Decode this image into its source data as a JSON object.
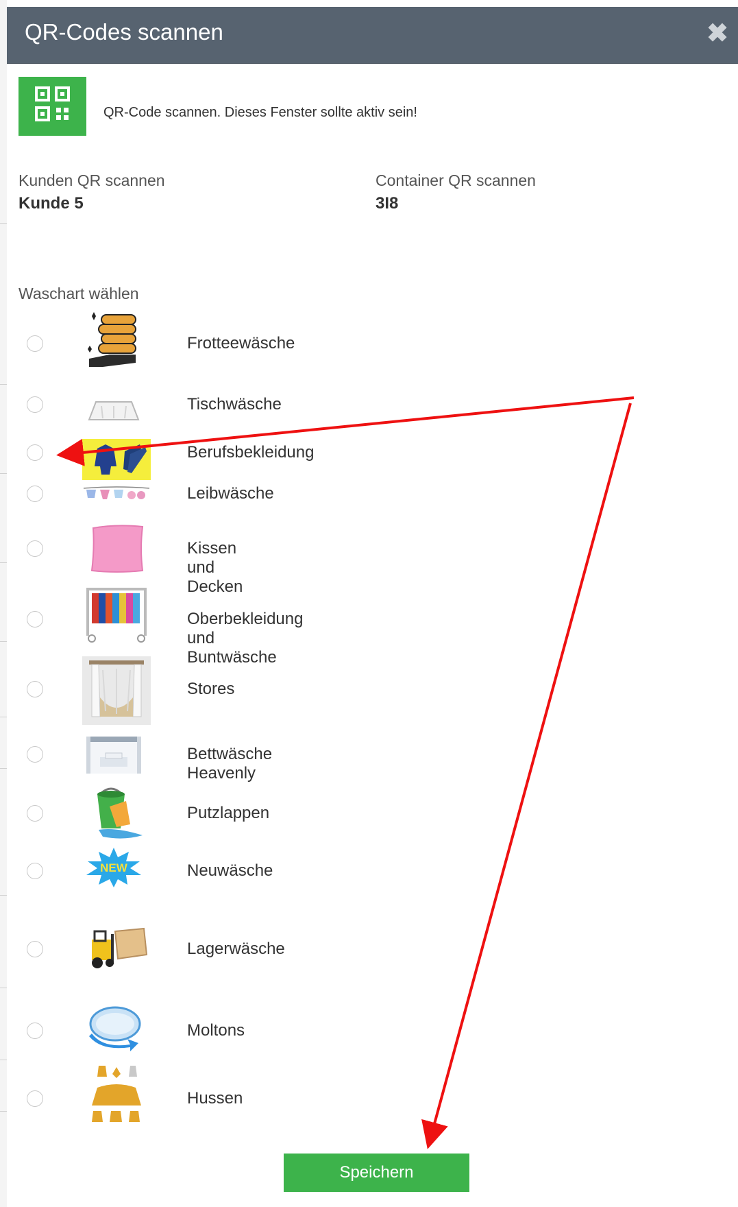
{
  "dialog": {
    "title": "QR-Codes scannen",
    "close_glyph": "✖",
    "hint": "QR-Code scannen. Dieses Fenster sollte aktiv sein!"
  },
  "customer": {
    "label": "Kunden QR scannen",
    "value": "Kunde 5"
  },
  "container": {
    "label": "Container QR scannen",
    "value": "3I8"
  },
  "wash_type": {
    "label": "Waschart wählen",
    "options": [
      {
        "label": "Frotteewäsche",
        "icon": "towel-stack-icon"
      },
      {
        "label": "Tischwäsche",
        "icon": "tablecloth-icon"
      },
      {
        "label": "Berufsbekleidung",
        "icon": "workwear-icon"
      },
      {
        "label": "Leibwäsche",
        "icon": "underwear-line-icon"
      },
      {
        "label": "Kissen und Decken",
        "icon": "pillow-icon"
      },
      {
        "label": "Oberbekleidung und Buntwäsche",
        "icon": "clothes-rack-icon"
      },
      {
        "label": "Stores",
        "icon": "curtain-icon"
      },
      {
        "label": "Bettwäsche Heavenly",
        "icon": "bed-icon"
      },
      {
        "label": "Putzlappen",
        "icon": "bucket-icon"
      },
      {
        "label": "Neuwäsche",
        "icon": "new-badge-icon"
      },
      {
        "label": "Lagerwäsche",
        "icon": "forklift-icon"
      },
      {
        "label": "Moltons",
        "icon": "molton-pad-icon"
      },
      {
        "label": "Hussen",
        "icon": "chair-cover-icon"
      }
    ]
  },
  "new_badge_text": "NEW",
  "save_label": "Speichern",
  "colors": {
    "header": "#576370",
    "accent": "#3db34b",
    "annotation": "#ee1111"
  }
}
